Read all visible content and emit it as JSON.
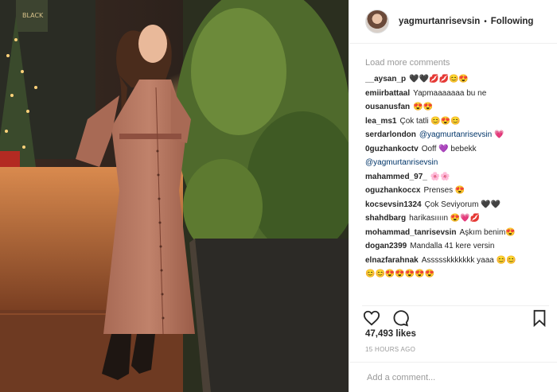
{
  "header": {
    "username": "yagmurtanrisevsin",
    "separator": "•",
    "follow_state": "Following"
  },
  "photo": {
    "sign_text": "BLACK"
  },
  "comments": {
    "load_more": "Load more comments",
    "items": [
      {
        "user": "__aysan_p",
        "text": "🖤🖤💋💋😊😍"
      },
      {
        "user": "emiirbattaal",
        "text": "Yapmaaaaaaa bu ne"
      },
      {
        "user": "ousanusfan",
        "text": "😍😍"
      },
      {
        "user": "lea_ms1",
        "text": "Çok tatli 😊😍😊"
      },
      {
        "user": "serdarlondon",
        "mention": "@yagmurtanrisevsin",
        "text": "💗"
      },
      {
        "user": "0guzhankoctv",
        "text": "Ooff 💜 bebekk"
      },
      {
        "user": "",
        "mention": "@yagmurtanrisevsin",
        "text": ""
      },
      {
        "user": "mahammed_97_",
        "text": "🌸🌸"
      },
      {
        "user": "oguzhankoccx",
        "text": "Prenses 😍"
      },
      {
        "user": "kocsevsin1324",
        "text": "Çok Seviyorum 🖤🖤"
      },
      {
        "user": "shahdbarg",
        "text": "harikasıııın 😍💗💋"
      },
      {
        "user": "mohammad_tanrisevsin",
        "text": "Aşkım benim😍"
      },
      {
        "user": "dogan2399",
        "text": "Mandalla 41 kere versin"
      },
      {
        "user": "elnazfarahnak",
        "text": "Assssskkkkkkk yaaa 😊😊"
      },
      {
        "user": "",
        "text": "😊😊😍😍😍😍😍"
      }
    ]
  },
  "actions": {
    "like_icon": "heart-icon",
    "comment_icon": "comment-icon",
    "save_icon": "bookmark-icon"
  },
  "likes_text": "47,493 likes",
  "timestamp": "15 HOURS AGO",
  "add_comment_placeholder": "Add a comment..."
}
